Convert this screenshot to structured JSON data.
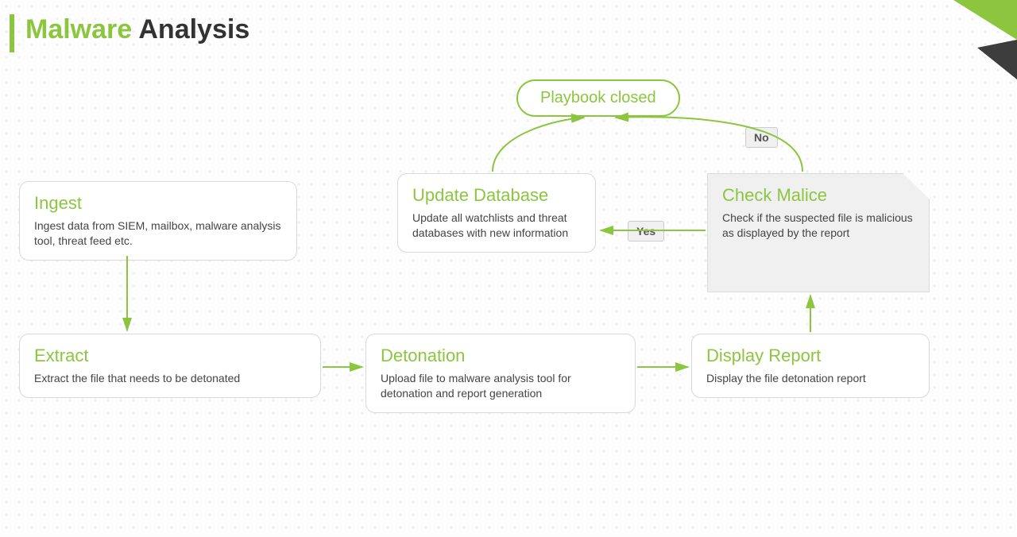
{
  "title_word1": "Malware",
  "title_word2": "Analysis",
  "nodes": {
    "ingest": {
      "title": "Ingest",
      "body": "Ingest data from SIEM, mailbox, malware analysis tool, threat feed etc."
    },
    "extract": {
      "title": "Extract",
      "body": "Extract the file that needs to be detonated"
    },
    "detonation": {
      "title": "Detonation",
      "body": "Upload file to malware analysis tool for detonation and report generation"
    },
    "display": {
      "title": "Display Report",
      "body": "Display the file detonation report"
    },
    "check": {
      "title": "Check Malice",
      "body": "Check if the suspected file is malicious as displayed by the report"
    },
    "update": {
      "title": "Update Database",
      "body": "Update all watchlists and threat databases with new information"
    }
  },
  "terminal": "Playbook closed",
  "labels": {
    "yes": "Yes",
    "no": "No"
  },
  "colors": {
    "accent": "#8CC63F",
    "dark": "#3d3d3d"
  }
}
